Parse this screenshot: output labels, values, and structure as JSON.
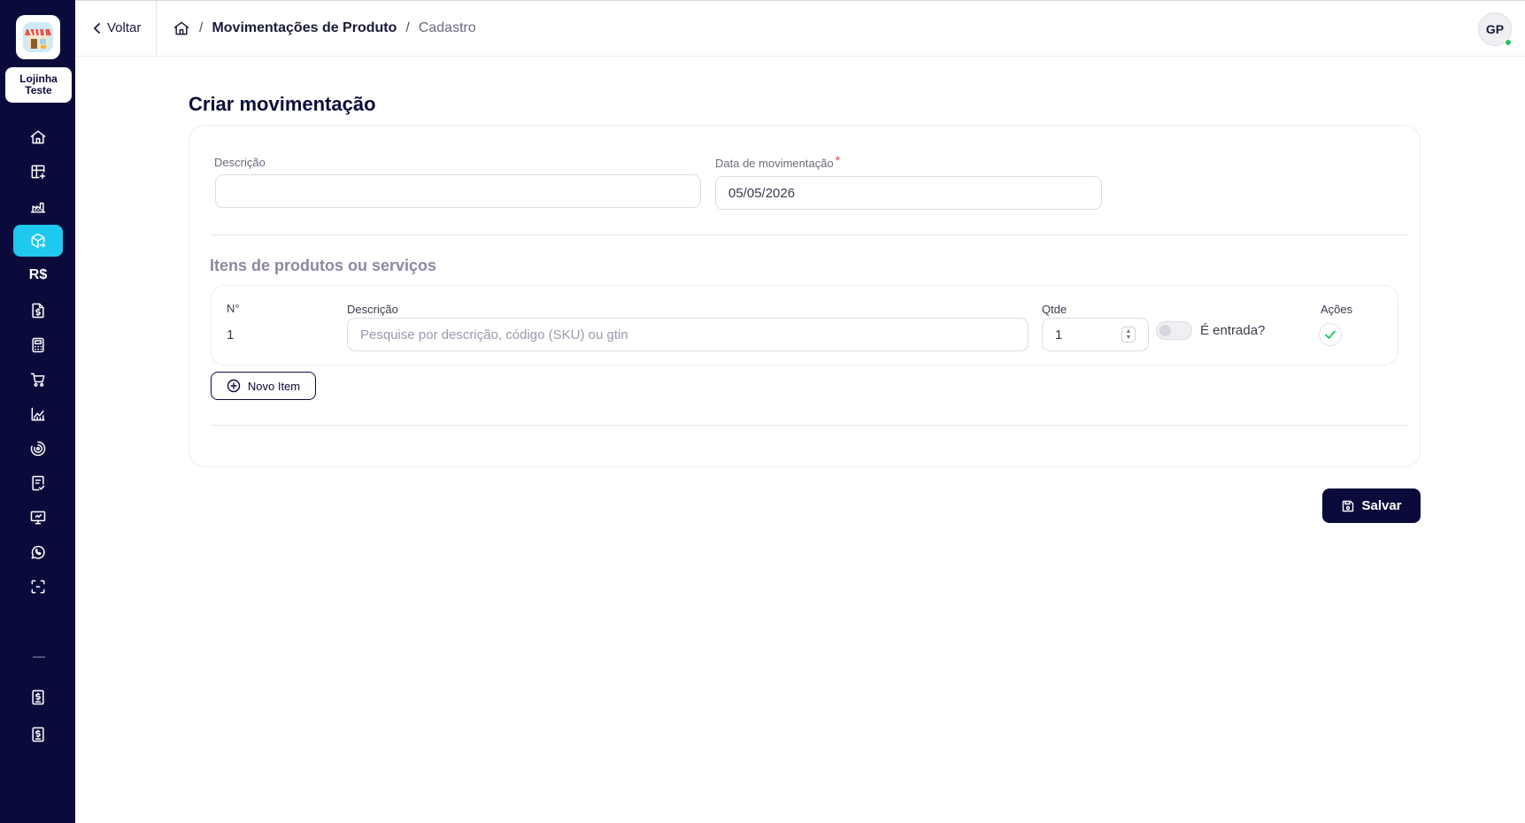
{
  "store": {
    "name": "Lojinha Teste"
  },
  "sidebar": {
    "items": [
      {
        "name": "nav-home",
        "icon": "home-icon"
      },
      {
        "name": "nav-dashboard",
        "icon": "table-add-icon"
      },
      {
        "name": "nav-factory",
        "icon": "factory-icon"
      },
      {
        "name": "nav-products",
        "icon": "box-transfer-icon",
        "active": true
      },
      {
        "name": "nav-finance",
        "text": "R$"
      },
      {
        "name": "nav-invoice",
        "icon": "dollar-doc-icon"
      },
      {
        "name": "nav-calculator",
        "icon": "calculator-icon"
      },
      {
        "name": "nav-cart",
        "icon": "cart-icon"
      },
      {
        "name": "nav-reports",
        "icon": "chart-icon"
      },
      {
        "name": "nav-target",
        "icon": "target-icon"
      },
      {
        "name": "nav-checklist",
        "icon": "checklist-icon"
      },
      {
        "name": "nav-pdv",
        "icon": "monitor-icon"
      },
      {
        "name": "nav-whatsapp",
        "icon": "whatsapp-icon"
      },
      {
        "name": "nav-scan",
        "icon": "scan-icon"
      },
      {
        "name": "nav-receipt-1",
        "icon": "receipt-dollar-icon"
      },
      {
        "name": "nav-receipt-2",
        "icon": "receipt-dollar-icon"
      }
    ]
  },
  "topbar": {
    "back_label": "Voltar",
    "breadcrumb": {
      "section": "Movimentações de Produto",
      "current": "Cadastro"
    },
    "avatar_initials": "GP",
    "status_color": "#22c55e"
  },
  "form": {
    "title": "Criar movimentação",
    "description_label": "Descrição",
    "description_value": "",
    "date_label": "Data de movimentação",
    "date_required_mark": "*",
    "date_value": "05/05/2026"
  },
  "items": {
    "section_title": "Itens de produtos ou serviços",
    "columns": {
      "number": "N°",
      "description": "Descrição",
      "qty": "Qtde",
      "actions": "Ações"
    },
    "rows": [
      {
        "number": "1",
        "description_placeholder": "Pesquise por descrição, código (SKU) ou gtin",
        "qty": "1",
        "is_entry_label": "É entrada?",
        "is_entry": false
      }
    ],
    "add_button": "Novo Item"
  },
  "actions": {
    "save_label": "Salvar"
  },
  "colors": {
    "sidebar": "#0b0b3b",
    "accent": "#1ec8ee",
    "primary": "#0b0b3b",
    "success": "#22c55e"
  }
}
